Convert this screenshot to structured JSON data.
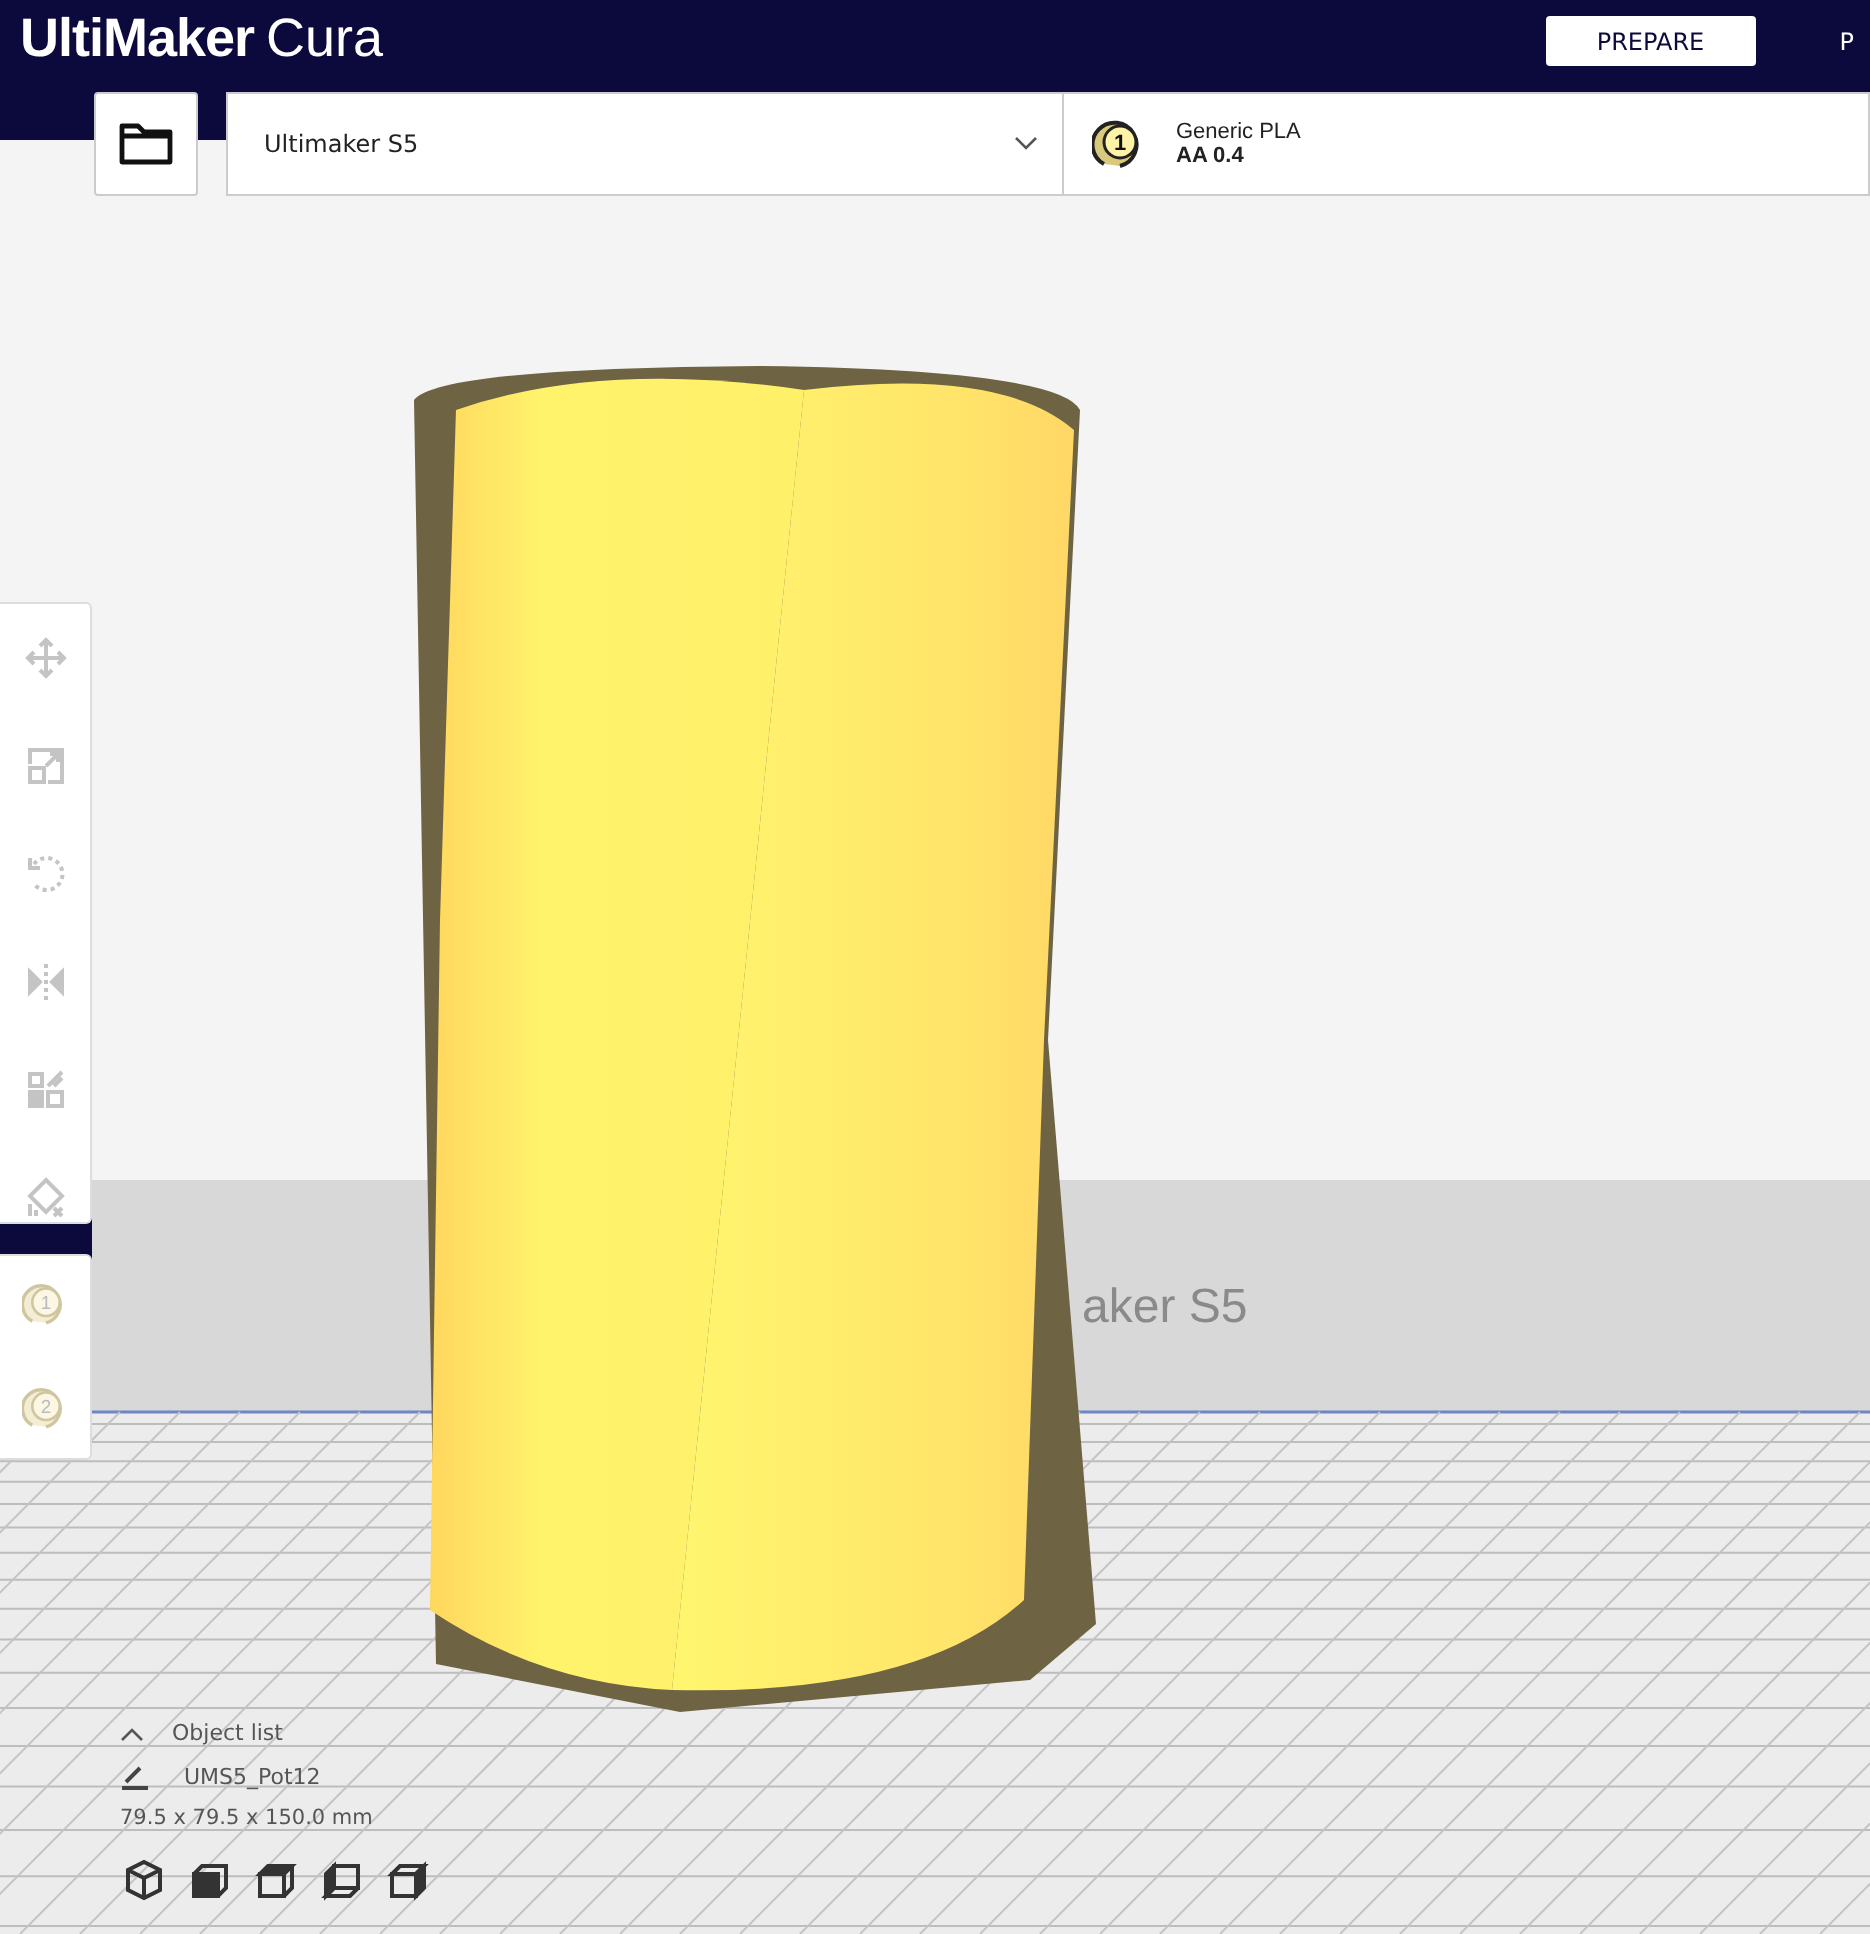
{
  "app": {
    "brand": "UltiMaker",
    "product": "Cura"
  },
  "stages": [
    {
      "label": "PREPARE",
      "selected": true
    },
    {
      "label": "P",
      "selected": false
    }
  ],
  "printer": {
    "name": "Ultimaker S5"
  },
  "material": {
    "extruder": "1",
    "name": "Generic PLA",
    "nozzle": "AA 0.4"
  },
  "tools": [
    {
      "kind": "move"
    },
    {
      "kind": "scale"
    },
    {
      "kind": "rotate"
    },
    {
      "kind": "mirror"
    },
    {
      "kind": "per-model"
    },
    {
      "kind": "support-blocker"
    }
  ],
  "extruders": [
    {
      "label": "1"
    },
    {
      "label": "2"
    }
  ],
  "plate_label": "aker S5",
  "object_list": {
    "title": "Object list",
    "name": "UMS5_Pot12",
    "dimensions": "79.5 x 79.5 x 150.0 mm"
  },
  "views": [
    {
      "kind": "perspective"
    },
    {
      "kind": "front"
    },
    {
      "kind": "top"
    },
    {
      "kind": "left"
    },
    {
      "kind": "right"
    }
  ]
}
